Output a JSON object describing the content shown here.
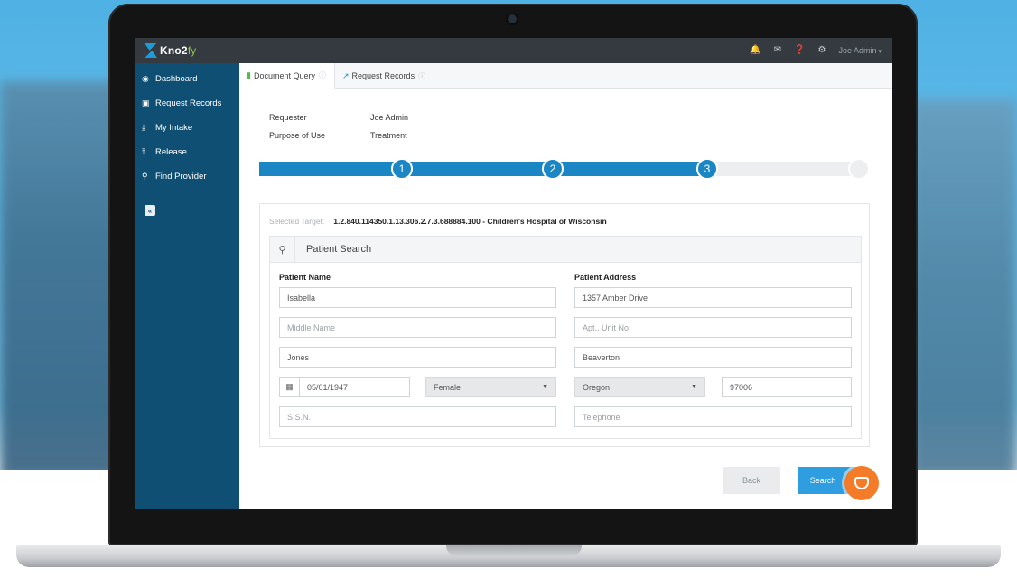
{
  "app": {
    "name": "Kno2",
    "name_suffix": "fy"
  },
  "topbar": {
    "icons": [
      "bell-icon",
      "envelope-icon",
      "question-icon",
      "gear-icon"
    ],
    "user": "Joe Admin"
  },
  "sidebar": {
    "items": [
      {
        "label": "Dashboard",
        "icon": "dashboard-icon"
      },
      {
        "label": "Request Records",
        "icon": "document-icon"
      },
      {
        "label": "My Intake",
        "icon": "download-icon"
      },
      {
        "label": "Release",
        "icon": "upload-icon"
      },
      {
        "label": "Find Provider",
        "icon": "search-icon"
      }
    ]
  },
  "tabs": [
    {
      "label": "Document Query",
      "active": true
    },
    {
      "label": "Request Records",
      "active": false
    }
  ],
  "meta": {
    "requester_label": "Requester",
    "requester_value": "Joe Admin",
    "purpose_label": "Purpose of Use",
    "purpose_value": "Treatment"
  },
  "steps": {
    "labels": [
      "1",
      "2",
      "3"
    ],
    "current": 3
  },
  "target": {
    "label": "Selected Target:",
    "value": "1.2.840.114350.1.13.306.2.7.3.688884.100 - Children's Hospital of Wisconsin"
  },
  "patient_search": {
    "title": "Patient Search",
    "name_label": "Patient Name",
    "address_label": "Patient Address",
    "first_name": "Isabella",
    "middle_name_placeholder": "Middle Name",
    "last_name": "Jones",
    "dob": "05/01/1947",
    "gender": "Female",
    "ssn_placeholder": "S.S.N.",
    "street": "1357 Amber Drive",
    "unit_placeholder": "Apt., Unit No.",
    "city": "Beaverton",
    "state": "Oregon",
    "zip": "97006",
    "telephone_placeholder": "Telephone"
  },
  "buttons": {
    "back": "Back",
    "search": "Search"
  },
  "colors": {
    "sidebar": "#0f4f73",
    "topbar": "#343a3f",
    "progress": "#1a86c4",
    "search_button": "#2f9ee0",
    "chat_button": "#f47b27"
  }
}
